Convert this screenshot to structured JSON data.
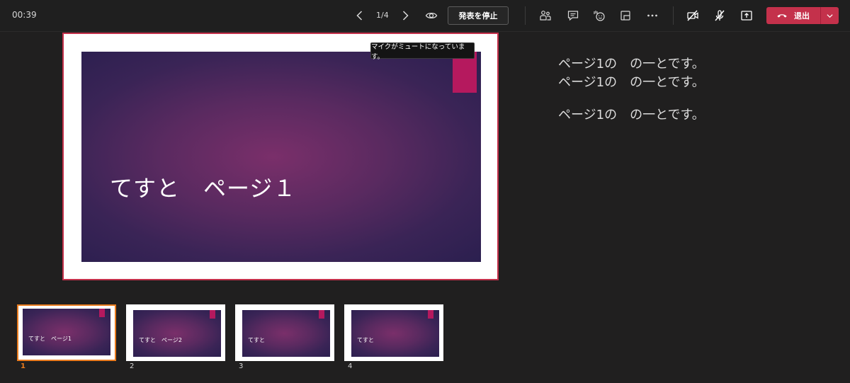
{
  "toolbar": {
    "timer": "00:39",
    "page_counter": "1/4",
    "stop_presenting_label": "発表を停止",
    "leave_label": "退出",
    "icons": [
      "chevron-left-icon",
      "chevron-right-icon",
      "eye-icon",
      "people-icon",
      "chat-icon",
      "raise-hand-icon",
      "rooms-icon",
      "more-icon",
      "camera-off-icon",
      "mic-off-icon",
      "share-icon",
      "hang-up-icon",
      "chevron-down-icon"
    ],
    "leave_color": "#c4314b"
  },
  "slide": {
    "title": "てすと　ページ１",
    "accent_color": "#b5195e",
    "border_color": "#c4314b"
  },
  "tooltip": {
    "text": "マイクがミュートになっています。"
  },
  "notes": {
    "lines": [
      "ページ1の　の一とです。",
      "ページ1の　の一とです。",
      "",
      "ページ1の　の一とです。"
    ]
  },
  "thumbnails": [
    {
      "number": "1",
      "title": "てすと　ページ1",
      "active": true
    },
    {
      "number": "2",
      "title": "てすと　ページ2",
      "active": false
    },
    {
      "number": "3",
      "title": "てすと",
      "active": false
    },
    {
      "number": "4",
      "title": "てすと",
      "active": false
    }
  ],
  "colors": {
    "background": "#201f1f",
    "active_thumbnail": "#e97b1e"
  }
}
